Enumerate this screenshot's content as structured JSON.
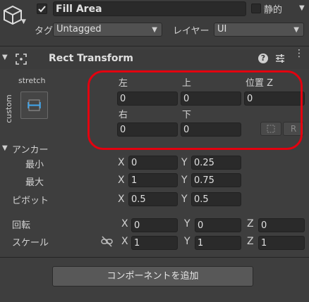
{
  "header": {
    "object_name": "Fill Area",
    "static_label": "静的",
    "tag_label": "タグ",
    "tag_value": "Untagged",
    "layer_label": "レイヤー",
    "layer_value": "UI"
  },
  "rect_transform": {
    "title": "Rect Transform",
    "anchor_preset_horizontal": "stretch",
    "anchor_preset_vertical": "custom",
    "left_label": "左",
    "top_label": "上",
    "posz_label": "位置 Z",
    "right_label": "右",
    "bottom_label": "下",
    "left": "0",
    "top": "0",
    "posz": "0",
    "right": "0",
    "bottom": "0",
    "r_button": "R"
  },
  "anchors": {
    "label": "アンカー",
    "min_label": "最小",
    "max_label": "最大",
    "min_x": "0",
    "min_y": "0.25",
    "max_x": "1",
    "max_y": "0.75"
  },
  "pivot": {
    "label": "ピボット",
    "x": "0.5",
    "y": "0.5"
  },
  "rotation": {
    "label": "回転",
    "x": "0",
    "y": "0",
    "z": "0"
  },
  "scale": {
    "label": "スケール",
    "x": "1",
    "y": "1",
    "z": "1"
  },
  "axis_labels": {
    "x": "X",
    "y": "Y",
    "z": "Z"
  },
  "add_component_label": "コンポーネントを追加",
  "colors": {
    "background": "#3e3e3e",
    "field": "#2a2a2a",
    "highlight": "#e3000f"
  }
}
